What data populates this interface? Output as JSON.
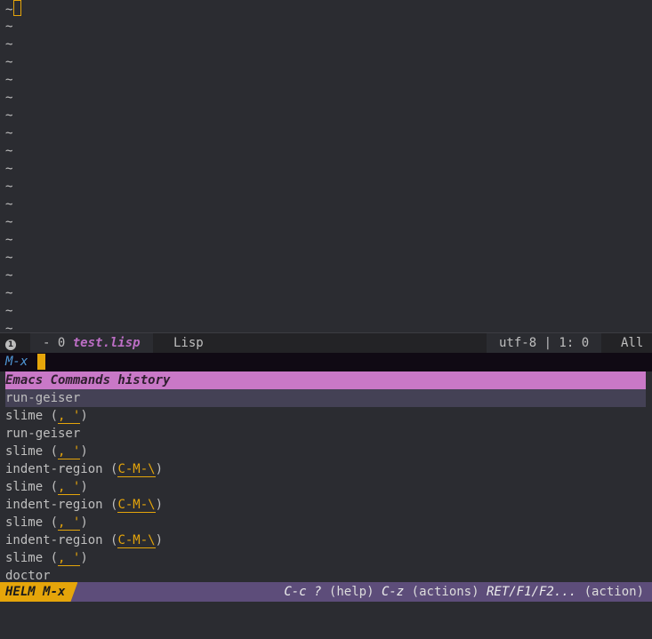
{
  "editor": {
    "tilde": "~",
    "tilde_count": 18
  },
  "modeline": {
    "window_number": "1",
    "modified": "- 0",
    "buffer_name": "test.lisp",
    "major_mode": "Lisp",
    "encoding_position": "utf-8 | 1: 0",
    "scroll": "All"
  },
  "minibuffer": {
    "prompt": "M-x"
  },
  "helm": {
    "source_header": "Emacs Commands history",
    "rows": [
      {
        "command": "run-geiser",
        "key": "",
        "selected": true
      },
      {
        "command": "slime",
        "key": ", '",
        "selected": false
      },
      {
        "command": "run-geiser",
        "key": "",
        "selected": false
      },
      {
        "command": "slime",
        "key": ", '",
        "selected": false
      },
      {
        "command": "indent-region",
        "key": "C-M-\\",
        "selected": false
      },
      {
        "command": "slime",
        "key": ", '",
        "selected": false
      },
      {
        "command": "indent-region",
        "key": "C-M-\\",
        "selected": false
      },
      {
        "command": "slime",
        "key": ", '",
        "selected": false
      },
      {
        "command": "indent-region",
        "key": "C-M-\\",
        "selected": false
      },
      {
        "command": "slime",
        "key": ", '",
        "selected": false
      },
      {
        "command": "doctor",
        "key": "",
        "selected": false
      }
    ]
  },
  "helm_modeline": {
    "label": "HELM M-x",
    "help_key_1": "C-c ?",
    "help_text_1": "(help)",
    "help_key_2": "C-z",
    "help_text_2": "(actions)",
    "help_key_3": "RET/F1/F2...",
    "help_text_3": "(action)"
  },
  "colors": {
    "background": "#2b2c31",
    "accent": "#e5a50a",
    "header": "#c978c7",
    "buffer_name": "#bc6ec5",
    "helm_modeline": "#5d4d7a"
  }
}
